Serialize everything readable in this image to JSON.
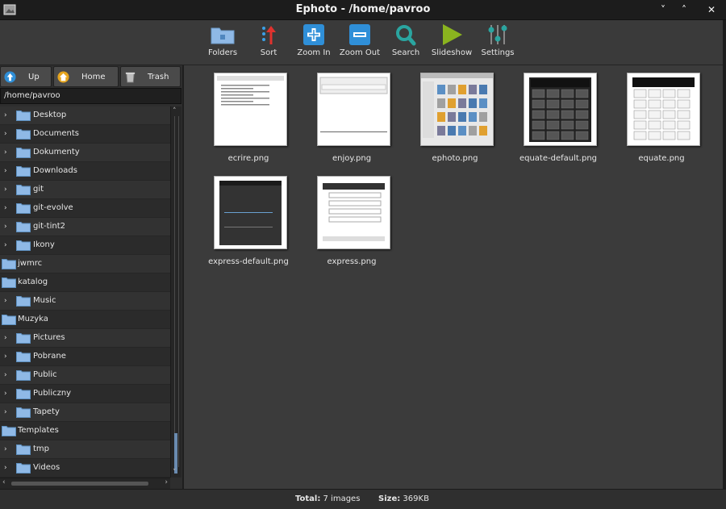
{
  "window": {
    "title": "Ephoto - /home/pavroo",
    "controls": [
      "˅",
      "˄",
      "✕"
    ]
  },
  "toolbar": {
    "items": [
      {
        "label": "Folders",
        "icon": "folder-icon"
      },
      {
        "label": "Sort",
        "icon": "sort-icon"
      },
      {
        "label": "Zoom In",
        "icon": "zoom-in-icon"
      },
      {
        "label": "Zoom Out",
        "icon": "zoom-out-icon"
      },
      {
        "label": "Search",
        "icon": "search-icon"
      },
      {
        "label": "Slideshow",
        "icon": "slideshow-icon"
      },
      {
        "label": "Settings",
        "icon": "settings-icon"
      }
    ]
  },
  "nav": {
    "up": "Up",
    "home": "Home",
    "trash": "Trash"
  },
  "path": "/home/pavroo",
  "tree": [
    {
      "label": "Desktop",
      "expandable": true
    },
    {
      "label": "Documents",
      "expandable": true
    },
    {
      "label": "Dokumenty",
      "expandable": true
    },
    {
      "label": "Downloads",
      "expandable": true
    },
    {
      "label": "git",
      "expandable": true
    },
    {
      "label": "git-evolve",
      "expandable": true
    },
    {
      "label": "git-tint2",
      "expandable": true
    },
    {
      "label": "Ikony",
      "expandable": true
    },
    {
      "label": "jwmrc",
      "expandable": false
    },
    {
      "label": "katalog",
      "expandable": false
    },
    {
      "label": "Music",
      "expandable": true
    },
    {
      "label": "Muzyka",
      "expandable": false
    },
    {
      "label": "Pictures",
      "expandable": true
    },
    {
      "label": "Pobrane",
      "expandable": true
    },
    {
      "label": "Public",
      "expandable": true
    },
    {
      "label": "Publiczny",
      "expandable": true
    },
    {
      "label": "Tapety",
      "expandable": true
    },
    {
      "label": "Templates",
      "expandable": false
    },
    {
      "label": "tmp",
      "expandable": true
    },
    {
      "label": "Videos",
      "expandable": true
    }
  ],
  "files": [
    {
      "name": "ecrire.png",
      "kind": "document"
    },
    {
      "name": "enjoy.png",
      "kind": "dialog"
    },
    {
      "name": "ephoto.png",
      "kind": "grid"
    },
    {
      "name": "equate-default.png",
      "kind": "calc-dark"
    },
    {
      "name": "equate.png",
      "kind": "calc-light"
    },
    {
      "name": "express-default.png",
      "kind": "dark-window"
    },
    {
      "name": "express.png",
      "kind": "form"
    }
  ],
  "status": {
    "total_label": "Total:",
    "total_value": "7 images",
    "size_label": "Size:",
    "size_value": "369KB"
  },
  "colors": {
    "folder": "#8fb9e6",
    "accent_blue": "#2f8fd8",
    "sort_red": "#e0322e",
    "search_teal": "#2aa5a0",
    "slideshow_green": "#8ab31f"
  }
}
